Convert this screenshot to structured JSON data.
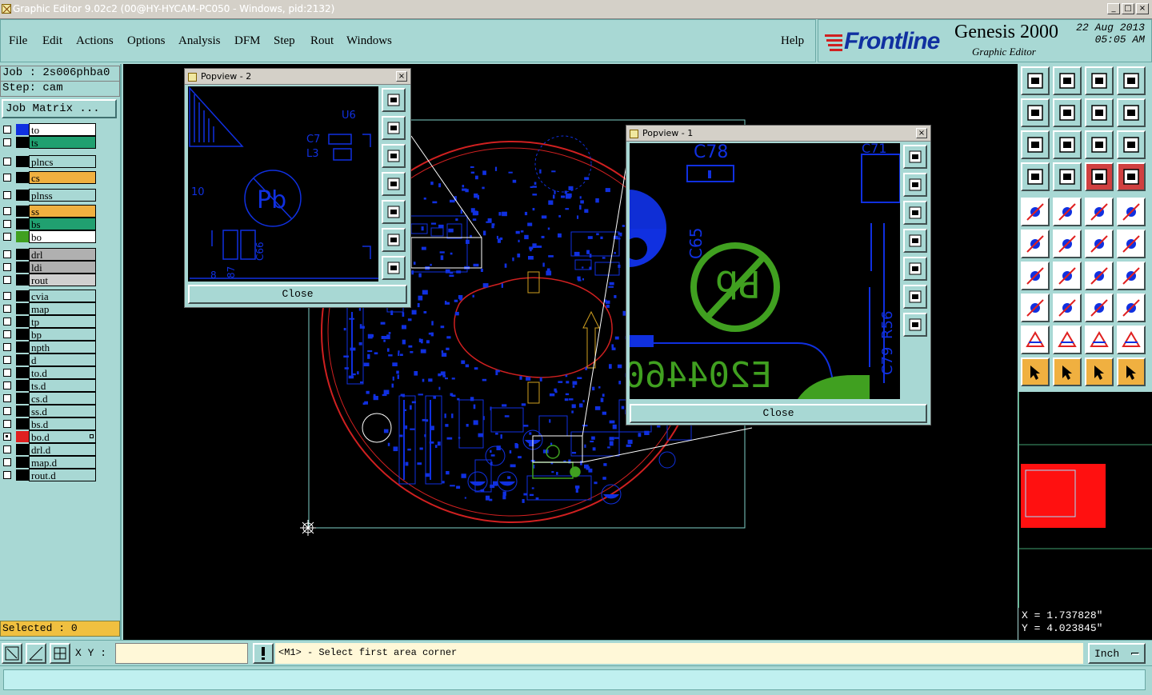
{
  "window": {
    "title": "Graphic Editor 9.02c2 (00@HY-HYCAM-PC050 - Windows, pid:2132)",
    "minimize": "_",
    "maximize": "□",
    "close": "×"
  },
  "menu": {
    "file": "File",
    "edit": "Edit",
    "actions": "Actions",
    "options": "Options",
    "analysis": "Analysis",
    "dfm": "DFM",
    "step": "Step",
    "rout": "Rout",
    "windows": "Windows",
    "help": "Help"
  },
  "brand": {
    "logo": "Frontline",
    "product": "Genesis 2000",
    "subtitle": "Graphic Editor",
    "date": "22  Aug  2013",
    "time": "05:05  AM"
  },
  "left": {
    "job": "Job : 2s006phba0",
    "step": "Step: cam",
    "job_matrix": "Job Matrix ...",
    "selected": "Selected : 0"
  },
  "layers": [
    {
      "name": "to",
      "color": "#1030e0",
      "fill": "#ffffff",
      "checked": false
    },
    {
      "name": "ts",
      "color": "#000000",
      "fill": "#20a070",
      "checked": false
    },
    {
      "name": "plncs",
      "color": "#000000",
      "fill": "#a8d8d4",
      "checked": false
    },
    {
      "name": "cs",
      "color": "#000000",
      "fill": "#f0b040",
      "checked": false
    },
    {
      "name": "plnss",
      "color": "#000000",
      "fill": "#a8d8d4",
      "checked": false
    },
    {
      "name": "ss",
      "color": "#000000",
      "fill": "#f0b040",
      "checked": false
    },
    {
      "name": "bs",
      "color": "#000000",
      "fill": "#20a070",
      "checked": false
    },
    {
      "name": "bo",
      "color": "#40a020",
      "fill": "#ffffff",
      "checked": false
    },
    {
      "name": "drl",
      "color": "#000000",
      "fill": "#b0b0b0",
      "checked": false
    },
    {
      "name": "ldi",
      "color": "#000000",
      "fill": "#b0b0b0",
      "checked": false
    },
    {
      "name": "rout",
      "color": "#000000",
      "fill": "#d0d0d0",
      "checked": false
    },
    {
      "name": "cvia",
      "color": "#000000",
      "fill": "#a8d8d4",
      "checked": false
    },
    {
      "name": "map",
      "color": "#000000",
      "fill": "#a8d8d4",
      "checked": false
    },
    {
      "name": "tp",
      "color": "#000000",
      "fill": "#a8d8d4",
      "checked": false
    },
    {
      "name": "bp",
      "color": "#000000",
      "fill": "#a8d8d4",
      "checked": false
    },
    {
      "name": "npth",
      "color": "#000000",
      "fill": "#a8d8d4",
      "checked": false
    },
    {
      "name": "d",
      "color": "#000000",
      "fill": "#a8d8d4",
      "checked": false
    },
    {
      "name": "to.d",
      "color": "#000000",
      "fill": "#a8d8d4",
      "checked": false
    },
    {
      "name": "ts.d",
      "color": "#000000",
      "fill": "#a8d8d4",
      "checked": false
    },
    {
      "name": "cs.d",
      "color": "#000000",
      "fill": "#a8d8d4",
      "checked": false
    },
    {
      "name": "ss.d",
      "color": "#000000",
      "fill": "#a8d8d4",
      "checked": false
    },
    {
      "name": "bs.d",
      "color": "#000000",
      "fill": "#a8d8d4",
      "checked": false
    },
    {
      "name": "bo.d",
      "color": "#e02020",
      "fill": "#a8d8d4",
      "checked": true
    },
    {
      "name": "drl.d",
      "color": "#000000",
      "fill": "#a8d8d4",
      "checked": false
    },
    {
      "name": "map.d",
      "color": "#000000",
      "fill": "#a8d8d4",
      "checked": false
    },
    {
      "name": "rout.d",
      "color": "#000000",
      "fill": "#a8d8d4",
      "checked": false
    }
  ],
  "popup2": {
    "title": "Popview - 2",
    "close_label": "Close",
    "labels": {
      "u6": "U6",
      "c7": "C7",
      "l3": "L3",
      "ten": "10",
      "c66": "C66",
      "b7": "87",
      "eight": "8"
    }
  },
  "popup1": {
    "title": "Popview - 1",
    "close_label": "Close",
    "labels": {
      "c78": "C78",
      "c71": "C71",
      "c65": "C65",
      "r56": "R56",
      "c79": "C79",
      "serial": "E204460",
      "pb": "Pb"
    }
  },
  "coords": {
    "x": "X = 1.737828\"",
    "y": "Y = 4.023845\""
  },
  "bottom": {
    "xy_label": "X Y :",
    "xy_value": "",
    "prompt": "<M1> - Select first area corner",
    "unit": "Inch"
  },
  "colors": {
    "panel": "#a8d8d4",
    "canvas": "#000000",
    "pcb_blue": "#1030e0",
    "pcb_green": "#40a020",
    "pcb_red": "#e02020",
    "outline": "#a0e0d8"
  }
}
